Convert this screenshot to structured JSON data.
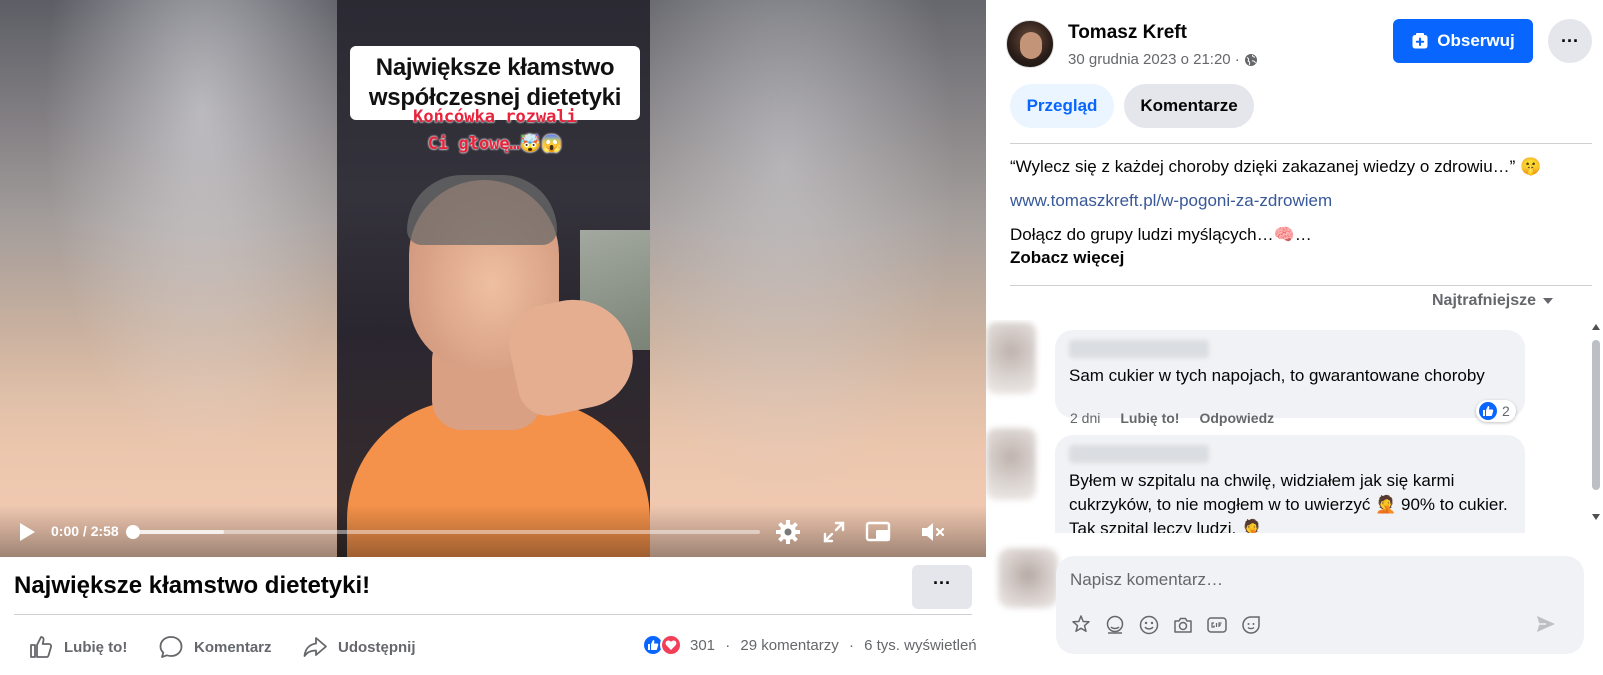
{
  "video": {
    "caption_line1": "Największe kłamstwo",
    "caption_line2": "współczesnej dietetyki",
    "overlay_line1": "Końcówka rozwali",
    "overlay_line2": "Ci głowę…🤯😱",
    "timecode": "0:00 / 2:58",
    "progress_fraction": 0.0
  },
  "post": {
    "title": "Największe kłamstwo dietetyki!",
    "more_label": "···",
    "actions": {
      "like": "Lubię to!",
      "comment": "Komentarz",
      "share": "Udostępnij"
    },
    "stats": {
      "reactions_count": "301",
      "comments": "29 komentarzy",
      "views": "6 tys. wyświetleń",
      "separator": "·"
    }
  },
  "sidebar": {
    "author": "Tomasz Kreft",
    "date": "30 grudnia 2023 o 21:20 ·",
    "follow_label": "Obserwuj",
    "menu_label": "···",
    "tabs": [
      {
        "label": "Przegląd",
        "active": true
      },
      {
        "label": "Komentarze",
        "active": false
      }
    ],
    "description": {
      "quote": "“Wylecz się z każdej choroby dzięki zakazanej wiedzy o zdrowiu…” 🤫",
      "link": "www.tomaszkreft.pl/w-pogoni-za-zdrowiem",
      "line3": "Dołącz do grupy ludzi myślących…🧠…",
      "see_more": "Zobacz więcej"
    },
    "sort_label": "Najtrafniejsze",
    "comments": [
      {
        "text": "Sam cukier w tych napojach, to gwarantowane choroby",
        "time": "2 dni",
        "like": "Lubię to!",
        "reply": "Odpowiedz",
        "likes": "2"
      },
      {
        "text": "Byłem w szpitalu na chwilę, widziałem jak się karmi cukrzyków, to nie mogłem w to uwierzyć 🤦 90% to cukier. Tak szpital leczy ludzi. 🤦"
      }
    ],
    "composer_placeholder": "Napisz komentarz…"
  },
  "colors": {
    "accent": "#0866ff",
    "muted_text": "#65676b",
    "bubble": "#f0f2f5"
  },
  "icons": [
    "play-icon",
    "settings-icon",
    "fullscreen-icon",
    "pip-icon",
    "volume-muted-icon",
    "like-icon",
    "comment-icon",
    "share-icon",
    "globe-icon",
    "follow-icon",
    "avatar-icon",
    "sticker-icon",
    "emoji-icon",
    "camera-icon",
    "gif-icon",
    "send-icon"
  ]
}
